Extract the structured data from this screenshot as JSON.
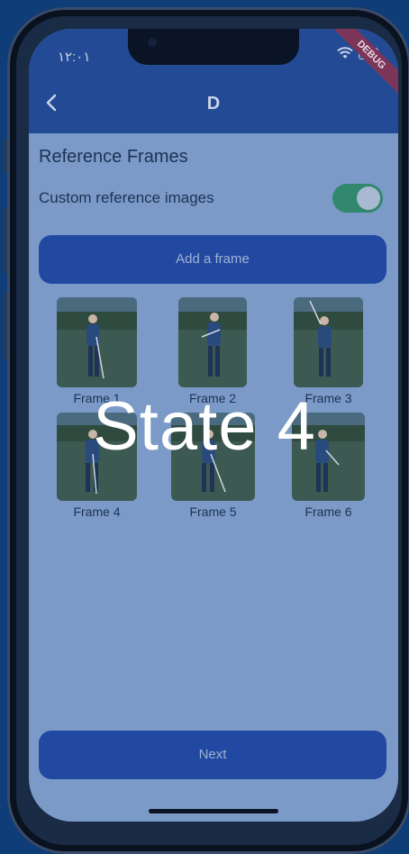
{
  "status": {
    "time": "١٢:٠١"
  },
  "debug_banner": "DEBUG",
  "appbar": {
    "title": "D"
  },
  "content": {
    "section_title": "Reference Frames",
    "custom_label": "Custom reference images",
    "custom_enabled": true,
    "add_button": "Add a frame",
    "frames": [
      {
        "label": "Frame 1"
      },
      {
        "label": "Frame 2"
      },
      {
        "label": "Frame 3"
      },
      {
        "label": "Frame 4"
      },
      {
        "label": "Frame 5"
      },
      {
        "label": "Frame 6"
      }
    ],
    "next_button": "Next"
  },
  "overlay": {
    "text": "State 4"
  },
  "colors": {
    "accent": "#2249a1",
    "toggle_on": "#31886c",
    "appbar": "#234a95"
  }
}
